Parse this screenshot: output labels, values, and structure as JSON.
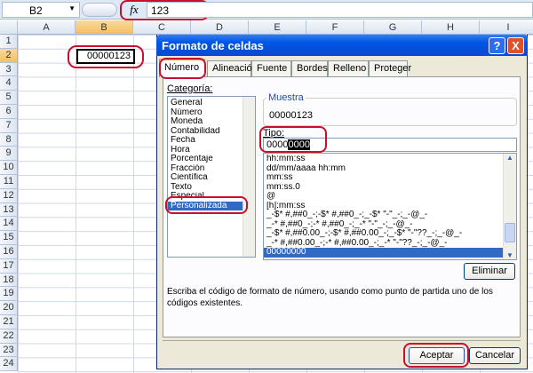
{
  "formula_bar": {
    "name_box": "B2",
    "fx_label": "fx",
    "formula": "123"
  },
  "columns": [
    "A",
    "B",
    "C",
    "D",
    "E",
    "F",
    "G",
    "H",
    "I"
  ],
  "rows": [
    "1",
    "2",
    "3",
    "4",
    "5",
    "6",
    "7",
    "8",
    "9",
    "10",
    "11",
    "12",
    "13",
    "14",
    "15",
    "16",
    "17",
    "18",
    "19",
    "20",
    "21",
    "22",
    "23",
    "24"
  ],
  "cell_b2": "00000123",
  "dialog": {
    "title": "Formato de celdas",
    "help": "?",
    "close": "X",
    "tabs": [
      "Número",
      "Alineación",
      "Fuente",
      "Bordes",
      "Relleno",
      "Proteger"
    ],
    "category_label": "Categoría:",
    "categories": [
      "General",
      "Número",
      "Moneda",
      "Contabilidad",
      "Fecha",
      "Hora",
      "Porcentaje",
      "Fracción",
      "Científica",
      "Texto",
      "Especial",
      "Personalizada"
    ],
    "selected_category": "Personalizada",
    "sample_label": "Muestra",
    "sample_value": "00000123",
    "type_label": "Tipo:",
    "type_value_plain": "0000",
    "type_value_selected": "0000",
    "formats": [
      "hh:mm:ss",
      "dd/mm/aaaa hh:mm",
      "mm:ss",
      "mm:ss.0",
      "@",
      "[h]:mm:ss",
      "_-$* #,##0_-;-$* #,##0_-;_-$* \"-\"_-;_-@_-",
      "_-* #,##0_-;-* #,##0_-;_-* \"-\"_-;_-@_-",
      "_-$* #,##0.00_-;-$* #,##0.00_-;_-$* \"-\"??_-;_-@_-",
      "_-* #,##0.00_-;-* #,##0.00_-;_-* \"-\"??_-;_-@_-",
      "00000000"
    ],
    "selected_format": "00000000",
    "delete_button": "Eliminar",
    "description": "Escriba el código de formato de número, usando como punto de partida uno de los códigos existentes.",
    "ok_button": "Aceptar",
    "cancel_button": "Cancelar"
  },
  "colors": {
    "highlight": "#c8102e",
    "selection": "#316ac5",
    "title_bar": "#0055e5"
  }
}
